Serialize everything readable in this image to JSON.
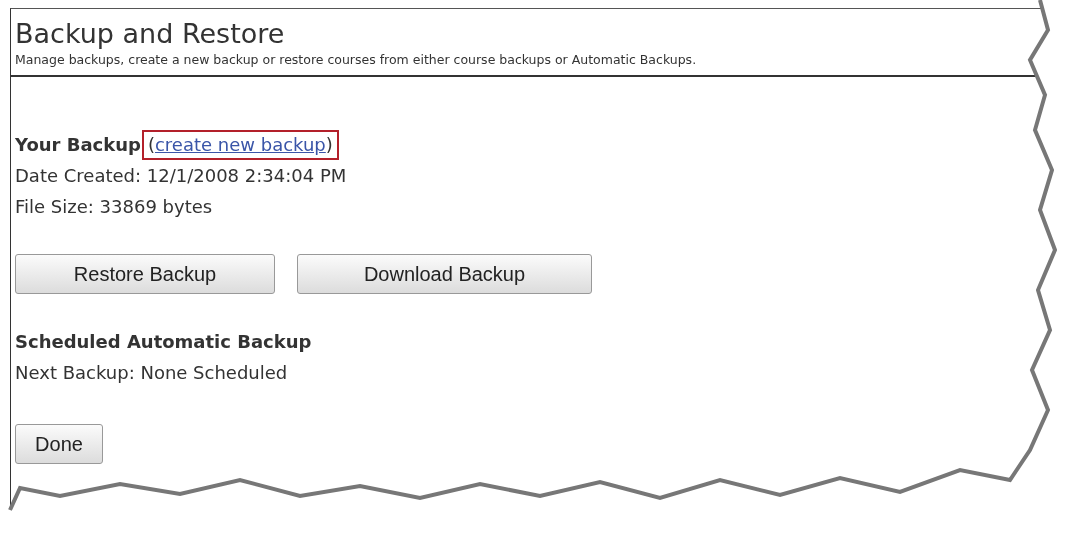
{
  "page": {
    "title": "Backup and Restore",
    "description": "Manage backups, create a new backup or restore courses from either course backups or Automatic Backups."
  },
  "your_backup": {
    "heading": "Your Backup",
    "link_open": "(",
    "link": "create new backup",
    "link_close": ")",
    "link_highlighted": true,
    "date_created": "Date Created: 12/1/2008 2:34:04 PM",
    "file_size": "File Size: 33869 bytes"
  },
  "buttons": [
    "Restore Backup",
    "Download Backup"
  ],
  "scheduled": {
    "heading": "Scheduled Automatic Backup",
    "next_backup": "Next Backup: None Scheduled"
  },
  "done_button": "Done"
}
